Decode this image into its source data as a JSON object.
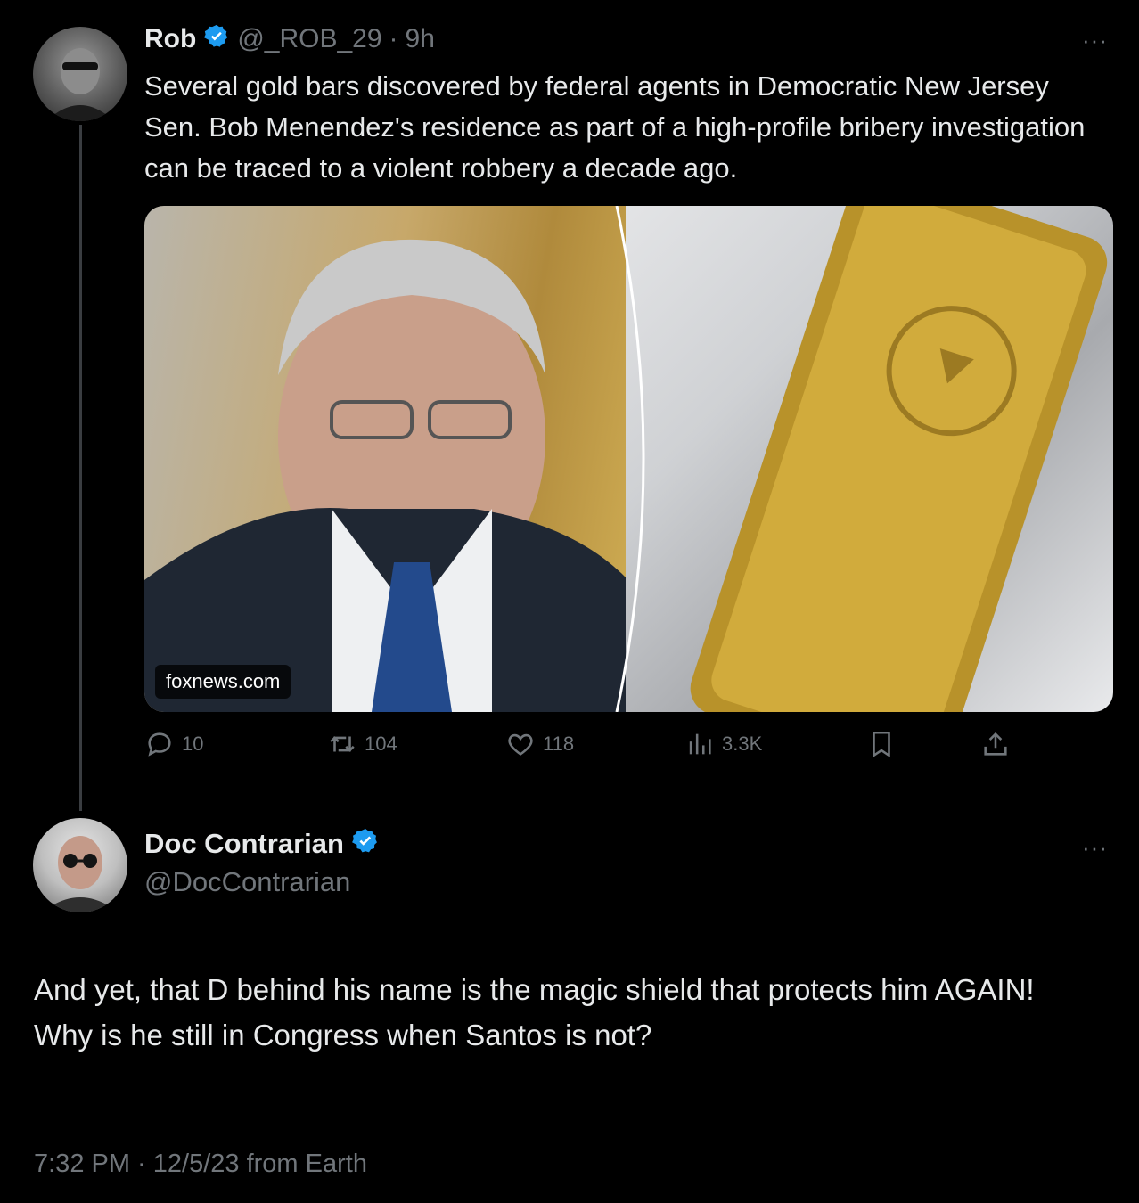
{
  "original_tweet": {
    "author_name": "Rob",
    "author_handle": "@_ROB_29",
    "separator": "·",
    "time_ago": "9h",
    "text": "Several gold bars discovered by federal agents in Democratic New Jersey Sen. Bob Menendez's residence as part of a high-profile bribery investigation can be traced to a violent robbery a decade ago.",
    "media_source": "foxnews.com",
    "metrics": {
      "replies": "10",
      "retweets": "104",
      "likes": "118",
      "views": "3.3K"
    },
    "more_label": "···"
  },
  "reply_tweet": {
    "author_name": "Doc Contrarian",
    "author_handle": "@DocContrarian",
    "text_line1": "And yet, that D behind his name is the magic shield that protects him AGAIN!",
    "text_line2": "Why is he still in Congress when Santos is not?",
    "timestamp": "7:32 PM · 12/5/23 from Earth",
    "more_label": "···"
  },
  "colors": {
    "background": "#000000",
    "text": "#e7e9ea",
    "muted": "#71767b",
    "verified": "#1d9bf0",
    "thread_line": "#3a3d41"
  },
  "icons": [
    "verified-badge-icon",
    "reply-icon",
    "retweet-icon",
    "like-icon",
    "views-icon",
    "bookmark-icon",
    "share-icon",
    "more-icon"
  ]
}
